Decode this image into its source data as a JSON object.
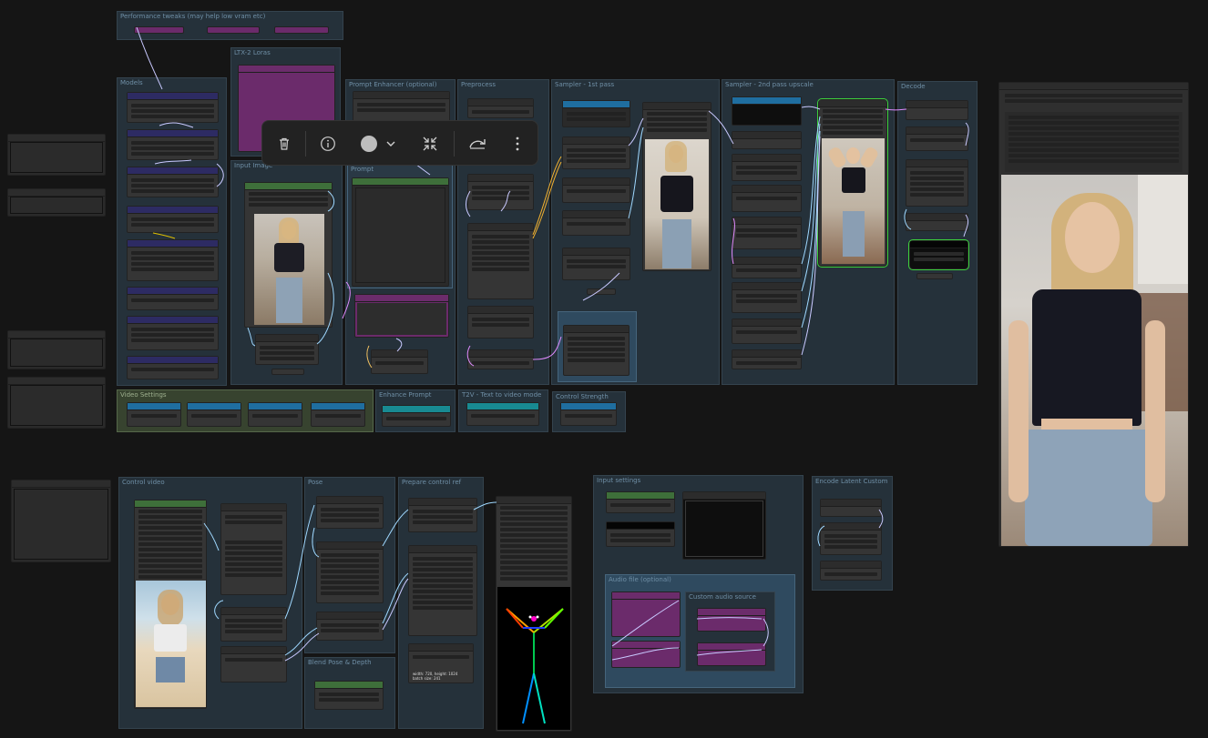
{
  "groups": {
    "performance": "Performance tweaks (may help low vram etc)",
    "models": "Models",
    "ltx_loras": "LTX-2 Loras",
    "input_image": "Input Image",
    "prompt_enhancer": "Prompt Enhancer (optional)",
    "prompt": "Prompt",
    "preprocess": "Preprocess",
    "sampler_1st": "Sampler - 1st pass",
    "sampler_2nd": "Sampler - 2nd pass upscale",
    "decode": "Decode",
    "video_settings": "Video Settings",
    "enhance_prompt": "Enhance Prompt",
    "t2v": "T2V - Text to video mode",
    "control_strength": "Control Strength",
    "control_video": "Control video",
    "pose": "Pose",
    "blend_pose_depth": "Blend Pose & Depth",
    "prepare_control_ref": "Prepare control ref",
    "input_settings": "Input settings",
    "audio_file": "Audio file (optional)",
    "custom_audio_source": "Custom audio source",
    "encode_latent_custom": "Encode Latent Custom"
  },
  "toolbar": {
    "delete": "delete-icon",
    "info": "info-icon",
    "color": "color-picker",
    "fit": "fit-view-icon",
    "bypass": "bypass-icon",
    "more": "more-options-icon",
    "color_swatch": "#bdbdbd"
  },
  "canvas": {
    "video_info_text": "width: 720, height: 1024\nbatch size: 241"
  },
  "colors": {
    "background": "#151515",
    "group_bg": "#25313a",
    "selection": "#3ccf3c",
    "lora_purple": "#6b2b6b"
  }
}
